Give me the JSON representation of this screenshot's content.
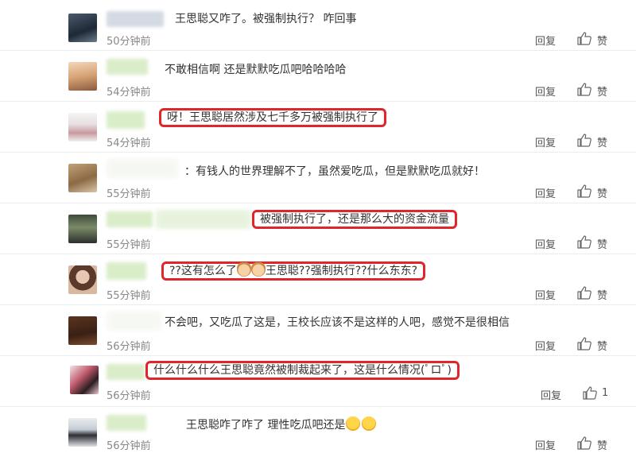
{
  "comments": [
    {
      "text": "王思聪又咋了。被强制执行？  咋回事",
      "time": "50分钟前",
      "reply": "回复",
      "like": "赞",
      "highlight": false
    },
    {
      "text": "不敢相信啊 还是默默吃瓜吧哈哈哈哈",
      "time": "54分钟前",
      "reply": "回复",
      "like": "赞",
      "highlight": false
    },
    {
      "text": "呀！王思聪居然涉及七千多万被强制执行了",
      "time": "54分钟前",
      "reply": "回复",
      "like": "赞",
      "highlight": true
    },
    {
      "text": "：有钱人的世界理解不了，虽然爱吃瓜，但是默默吃瓜就好！",
      "time": "55分钟前",
      "reply": "回复",
      "like": "赞",
      "highlight": false
    },
    {
      "text": "被强制执行了，还是那么大的资金流量",
      "time": "55分钟前",
      "reply": "回复",
      "like": "赞",
      "highlight": true
    },
    {
      "text_before": "??这有怎么了",
      "text_after": "王思聪??强制执行??什么东东?",
      "time": "55分钟前",
      "reply": "回复",
      "like": "赞",
      "highlight": true
    },
    {
      "text": "不会吧，又吃瓜了这是，王校长应该不是这样的人吧，感觉不是很相信",
      "time": "56分钟前",
      "reply": "回复",
      "like": "赞",
      "highlight": false
    },
    {
      "text": "什么什么什么王思聪竟然被制裁起来了，这是什么情况(ﾟロﾟ)",
      "time": "56分钟前",
      "reply": "回复",
      "like": "1",
      "highlight": true
    },
    {
      "text": "王思聪咋了咋了 理性吃瓜吧还是",
      "time": "56分钟前",
      "reply": "回复",
      "like": "赞",
      "highlight": false
    }
  ],
  "colors": {
    "highlight": "#e0262b",
    "name_blur": "#d6ecc4"
  },
  "icons": {
    "like": "thumbs-up-icon"
  }
}
